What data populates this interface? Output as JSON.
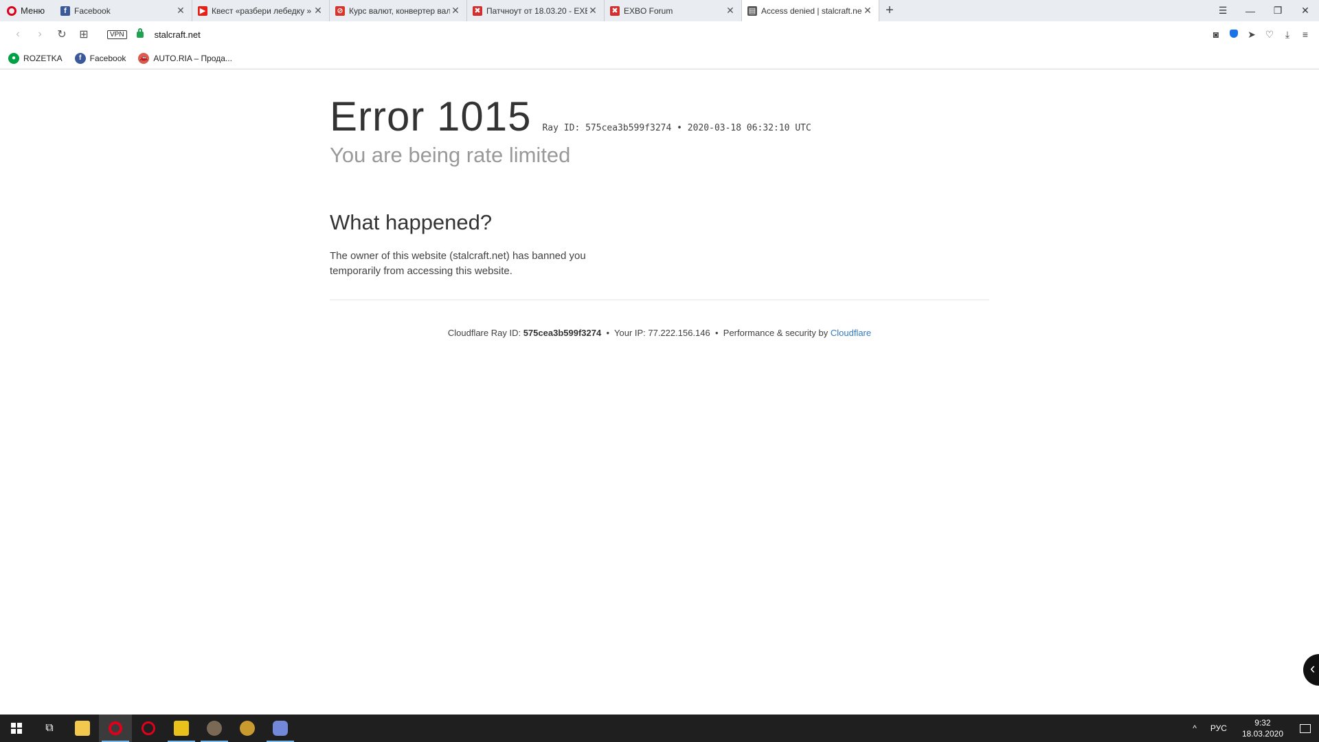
{
  "browser": {
    "menu_label": "Меню",
    "tabs": [
      {
        "title": "Facebook",
        "favicon": "facebook-icon",
        "color": "#3b5998",
        "glyph": "f",
        "active": false
      },
      {
        "title": "Квест «разбери лебедку »",
        "favicon": "youtube-icon",
        "color": "#e62117",
        "glyph": "▶",
        "active": false
      },
      {
        "title": "Курс валют, конвертер вал",
        "favicon": "no-sign-icon",
        "color": "#d9342b",
        "glyph": "⊘",
        "active": false
      },
      {
        "title": "Патчноут от 18.03.20 - EXB",
        "favicon": "exbo-icon",
        "color": "#d32f2f",
        "glyph": "✖",
        "active": false
      },
      {
        "title": "EXBO Forum",
        "favicon": "exbo-icon",
        "color": "#d32f2f",
        "glyph": "✖",
        "active": false
      },
      {
        "title": "Access denied | stalcraft.ne",
        "favicon": "document-icon",
        "color": "#555555",
        "glyph": "▤",
        "active": true
      }
    ],
    "address": {
      "vpn_label": "VPN",
      "url": "stalcraft.net"
    },
    "bookmarks": [
      {
        "label": "ROZETKA",
        "icon": "rozetka-icon",
        "color": "#00a046",
        "glyph": "●"
      },
      {
        "label": "Facebook",
        "icon": "facebook-icon",
        "color": "#3b5998",
        "glyph": "f"
      },
      {
        "label": "AUTO.RIA – Прода...",
        "icon": "car-icon",
        "color": "#db5c4c",
        "glyph": "🚗"
      }
    ]
  },
  "page": {
    "error_title": "Error 1015",
    "ray_line": "Ray ID: 575cea3b599f3274 • 2020-03-18 06:32:10 UTC",
    "subtitle": "You are being rate limited",
    "what_happened": "What happened?",
    "description": "The owner of this website (stalcraft.net) has banned you temporarily from accessing this website.",
    "footer": {
      "ray_label": "Cloudflare Ray ID:",
      "ray_id": "575cea3b599f3274",
      "ip_text": "Your IP: 77.222.156.146",
      "perf_text": "Performance & security by",
      "cloudflare_link": "Cloudflare",
      "separator": "•"
    },
    "link_color": "#2f7bbf"
  },
  "taskbar": {
    "language": "РУС",
    "time": "9:32",
    "date": "18.03.2020"
  }
}
